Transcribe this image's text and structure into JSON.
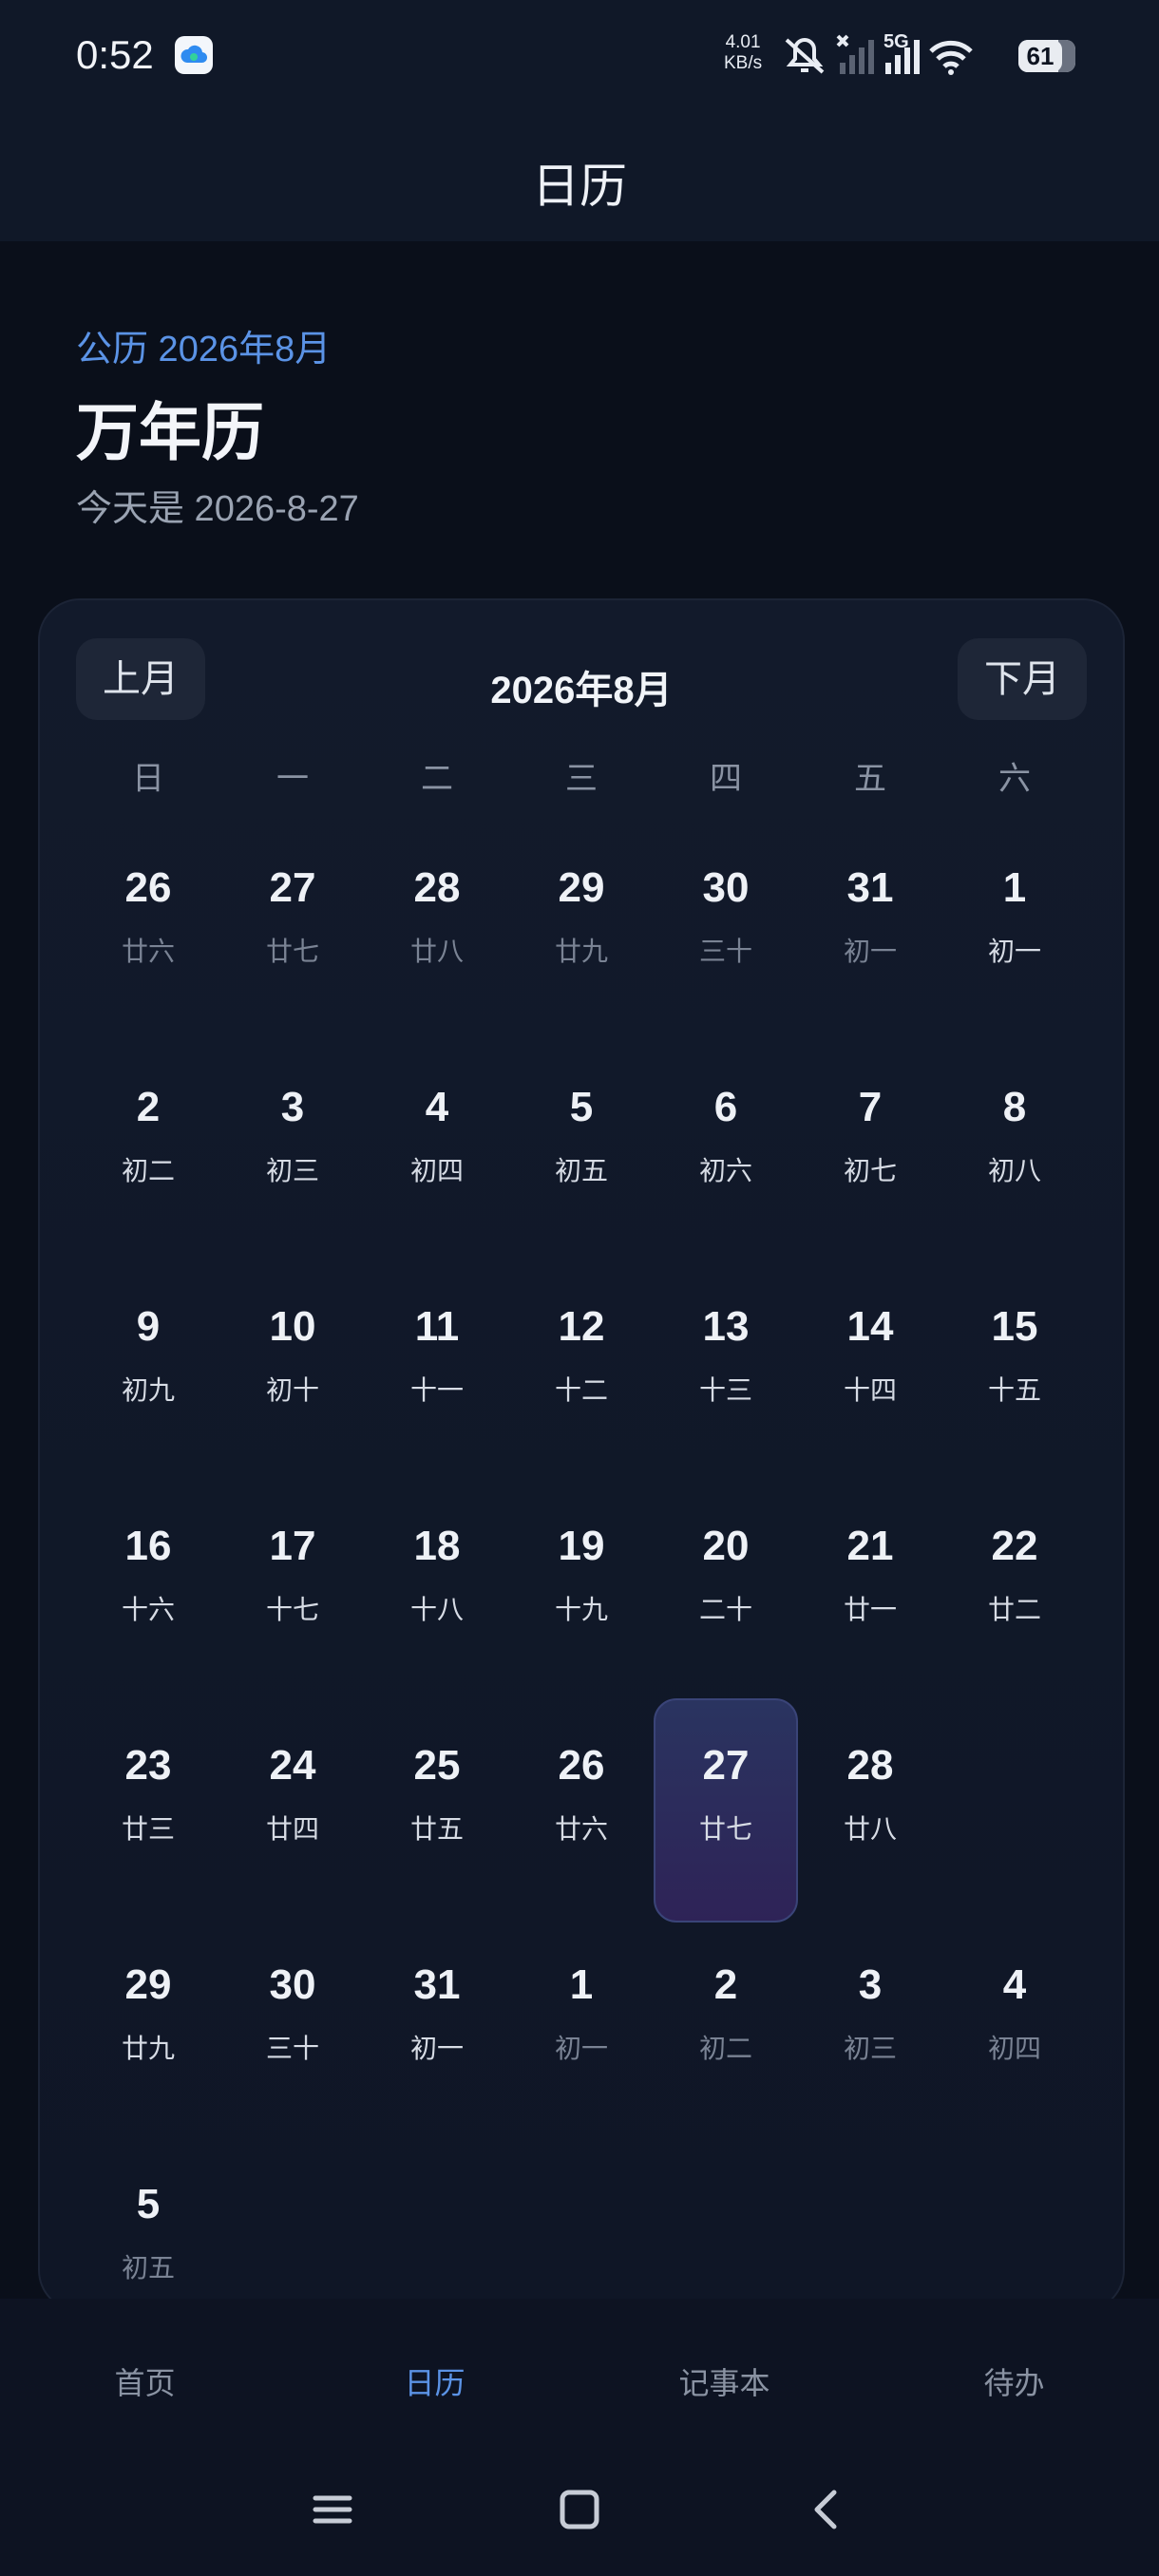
{
  "status": {
    "time": "0:52",
    "speed_value": "4.01",
    "speed_unit": "KB/s",
    "network": "5G",
    "battery": "61"
  },
  "title": "日历",
  "header": {
    "subtitle": "公历 2026年8月",
    "title": "万年历",
    "today_text": "今天是 2026-8-27"
  },
  "calendar": {
    "prev_label": "上月",
    "next_label": "下月",
    "month_title": "2026年8月",
    "weekdays": [
      "日",
      "一",
      "二",
      "三",
      "四",
      "五",
      "六"
    ],
    "weeks": [
      [
        {
          "n": "26",
          "l": "廿六",
          "other": true
        },
        {
          "n": "27",
          "l": "廿七",
          "other": true
        },
        {
          "n": "28",
          "l": "廿八",
          "other": true
        },
        {
          "n": "29",
          "l": "廿九",
          "other": true
        },
        {
          "n": "30",
          "l": "三十",
          "other": true
        },
        {
          "n": "31",
          "l": "初一",
          "other": true
        },
        {
          "n": "1",
          "l": "初一"
        }
      ],
      [
        {
          "n": "2",
          "l": "初二"
        },
        {
          "n": "3",
          "l": "初三"
        },
        {
          "n": "4",
          "l": "初四"
        },
        {
          "n": "5",
          "l": "初五"
        },
        {
          "n": "6",
          "l": "初六"
        },
        {
          "n": "7",
          "l": "初七"
        },
        {
          "n": "8",
          "l": "初八"
        }
      ],
      [
        {
          "n": "9",
          "l": "初九"
        },
        {
          "n": "10",
          "l": "初十"
        },
        {
          "n": "11",
          "l": "十一"
        },
        {
          "n": "12",
          "l": "十二"
        },
        {
          "n": "13",
          "l": "十三"
        },
        {
          "n": "14",
          "l": "十四"
        },
        {
          "n": "15",
          "l": "十五"
        }
      ],
      [
        {
          "n": "16",
          "l": "十六"
        },
        {
          "n": "17",
          "l": "十七"
        },
        {
          "n": "18",
          "l": "十八"
        },
        {
          "n": "19",
          "l": "十九"
        },
        {
          "n": "20",
          "l": "二十"
        },
        {
          "n": "21",
          "l": "廿一"
        },
        {
          "n": "22",
          "l": "廿二"
        }
      ],
      [
        {
          "n": "23",
          "l": "廿三"
        },
        {
          "n": "24",
          "l": "廿四"
        },
        {
          "n": "25",
          "l": "廿五"
        },
        {
          "n": "26",
          "l": "廿六"
        },
        {
          "n": "27",
          "l": "廿七",
          "today": true
        },
        {
          "n": "28",
          "l": "廿八"
        },
        null
      ],
      [
        {
          "n": "29",
          "l": "廿九"
        },
        {
          "n": "30",
          "l": "三十"
        },
        {
          "n": "31",
          "l": "初一"
        },
        {
          "n": "1",
          "l": "初一",
          "other": true
        },
        {
          "n": "2",
          "l": "初二",
          "other": true
        },
        {
          "n": "3",
          "l": "初三",
          "other": true
        },
        {
          "n": "4",
          "l": "初四",
          "other": true
        }
      ],
      [
        {
          "n": "5",
          "l": "初五",
          "other": true
        },
        null,
        null,
        null,
        null,
        null,
        null
      ]
    ]
  },
  "tabs": [
    {
      "label": "首页",
      "active": false
    },
    {
      "label": "日历",
      "active": true
    },
    {
      "label": "记事本",
      "active": false
    },
    {
      "label": "待办",
      "active": false
    }
  ],
  "system_nav": [
    "menu-icon",
    "home-square-icon",
    "back-chevron-icon"
  ]
}
